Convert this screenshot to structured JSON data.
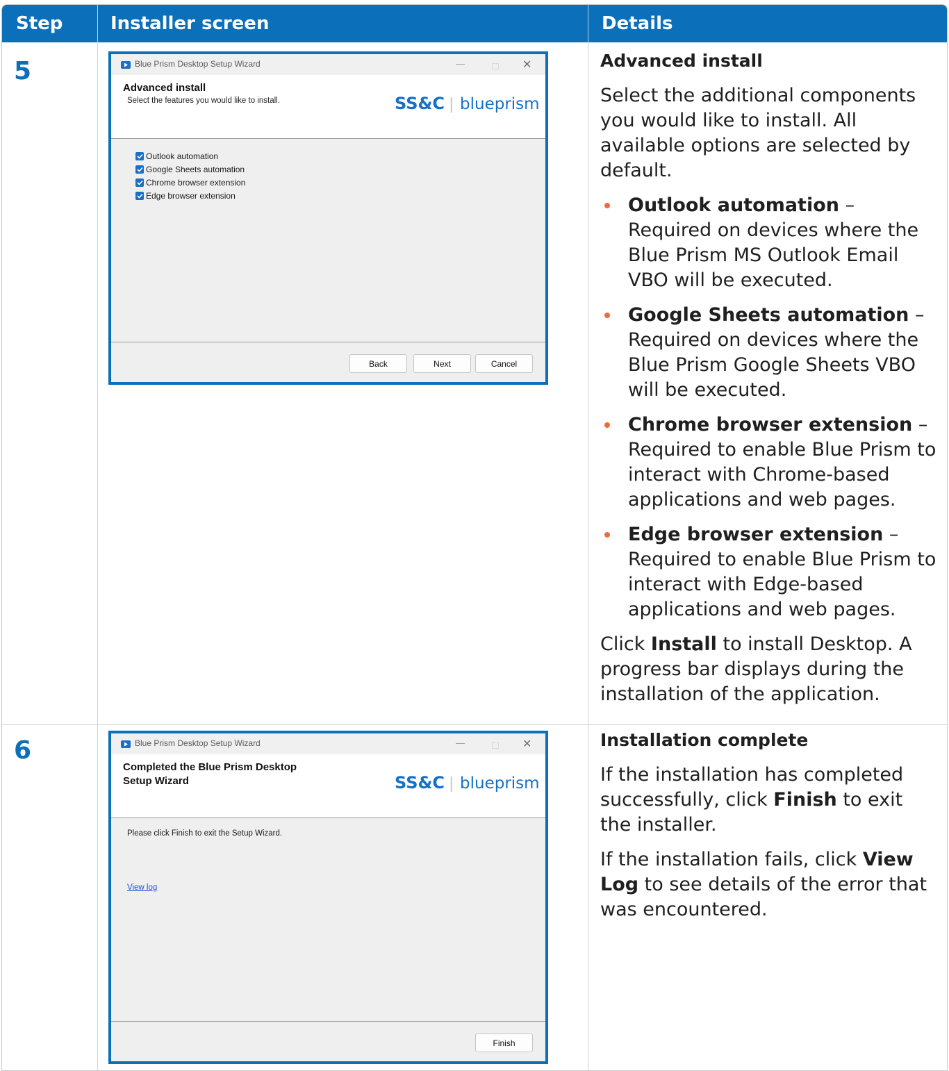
{
  "header": {
    "step": "Step",
    "installer_screen": "Installer screen",
    "details": "Details"
  },
  "colors": {
    "header_bg": "#0c6fb9",
    "step_number": "#0c6fb9",
    "bullet": "#ee6a3c",
    "checkbox": "#1c6fc6",
    "link": "#1a50d6"
  },
  "rows": [
    {
      "step": "5",
      "wizard": {
        "window_title": "Blue Prism Desktop Setup Wizard",
        "heading": "Advanced install",
        "subheading": "Select the features you would like to install.",
        "logo_left": "SS&C",
        "logo_sep": "|",
        "logo_right": "blueprism",
        "features": [
          {
            "label": "Outlook automation",
            "checked": true
          },
          {
            "label": "Google Sheets automation",
            "checked": true
          },
          {
            "label": "Chrome browser extension",
            "checked": true
          },
          {
            "label": "Edge browser extension",
            "checked": true
          }
        ],
        "buttons": {
          "back": "Back",
          "next": "Next",
          "cancel": "Cancel"
        }
      },
      "details": {
        "title": "Advanced install",
        "intro": "Select the additional components you would like to install. All available options are selected by default.",
        "items": [
          {
            "name": "Outlook automation",
            "text": " – Required on devices where the Blue Prism MS Outlook Email VBO will be executed."
          },
          {
            "name": "Google Sheets automation",
            "text": " – Required on devices where the Blue Prism Google Sheets VBO will be executed."
          },
          {
            "name": "Chrome browser extension",
            "text": " – Required to enable Blue Prism to interact with Chrome-based applications and web pages."
          },
          {
            "name": "Edge browser extension",
            "text": " – Required to enable Blue Prism to interact with Edge-based applications and web pages."
          }
        ],
        "outro_pre": "Click ",
        "outro_bold": "Install",
        "outro_post": " to install Desktop. A progress bar displays during the installation of the application."
      }
    },
    {
      "step": "6",
      "wizard": {
        "window_title": "Blue Prism Desktop Setup Wizard",
        "heading": "Completed the Blue Prism Desktop Setup Wizard",
        "body_text": "Please click Finish to exit the Setup Wizard.",
        "link": "View log",
        "buttons": {
          "finish": "Finish"
        }
      },
      "details": {
        "title": "Installation complete",
        "p1_pre": "If the installation has completed successfully, click ",
        "p1_bold": "Finish",
        "p1_post": " to exit the installer.",
        "p2_pre": "If the installation fails, click ",
        "p2_bold": "View Log",
        "p2_post": " to see details of the error that was encountered."
      }
    }
  ]
}
